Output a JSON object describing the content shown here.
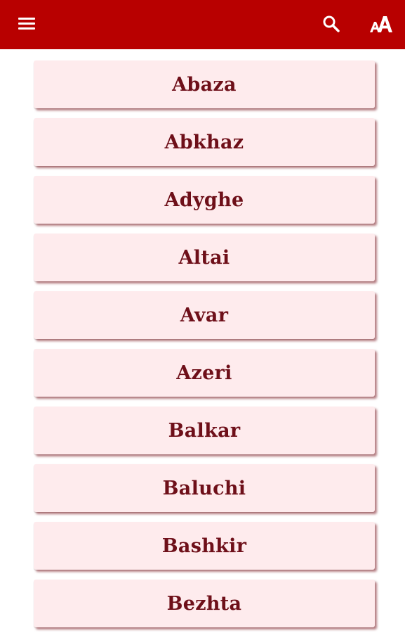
{
  "app_bar": {
    "background_color": "#b80000",
    "icons": {
      "menu": "hamburger-menu-icon",
      "search": "search-icon",
      "font_size": "font-size-icon"
    }
  },
  "list": {
    "button_color": "#feebed",
    "text_color": "#6e0f19",
    "items": [
      {
        "label": "Abaza"
      },
      {
        "label": "Abkhaz"
      },
      {
        "label": "Adyghe"
      },
      {
        "label": "Altai"
      },
      {
        "label": "Avar"
      },
      {
        "label": "Azeri"
      },
      {
        "label": "Balkar"
      },
      {
        "label": "Baluchi"
      },
      {
        "label": "Bashkir"
      },
      {
        "label": "Bezhta"
      }
    ]
  }
}
